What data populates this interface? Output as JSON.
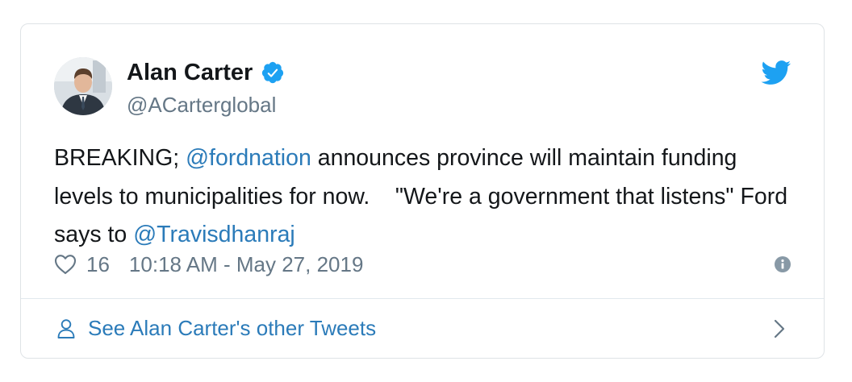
{
  "tweet": {
    "author_name": "Alan Carter",
    "author_handle": "@ACarterglobal",
    "text_parts": [
      "BREAKING; ",
      "@fordnation",
      " announces province will maintain funding levels to municipalities for now.    \"We're a government that listens\" Ford says to ",
      "@Travisdhanraj"
    ],
    "like_count": "16",
    "timestamp": "10:18 AM - May 27, 2019"
  },
  "footer": {
    "label": "See Alan Carter's other Tweets"
  },
  "icons": {
    "verified": "verified-badge-icon",
    "brand": "twitter-bird-icon",
    "like": "heart-icon",
    "info": "info-icon",
    "profile": "person-icon",
    "navigate": "chevron-right-icon"
  },
  "colors": {
    "accent": "#1da1f2",
    "link": "#2b7bb9",
    "text": "#14171a",
    "muted": "#657786",
    "border": "#dfe3e6"
  }
}
